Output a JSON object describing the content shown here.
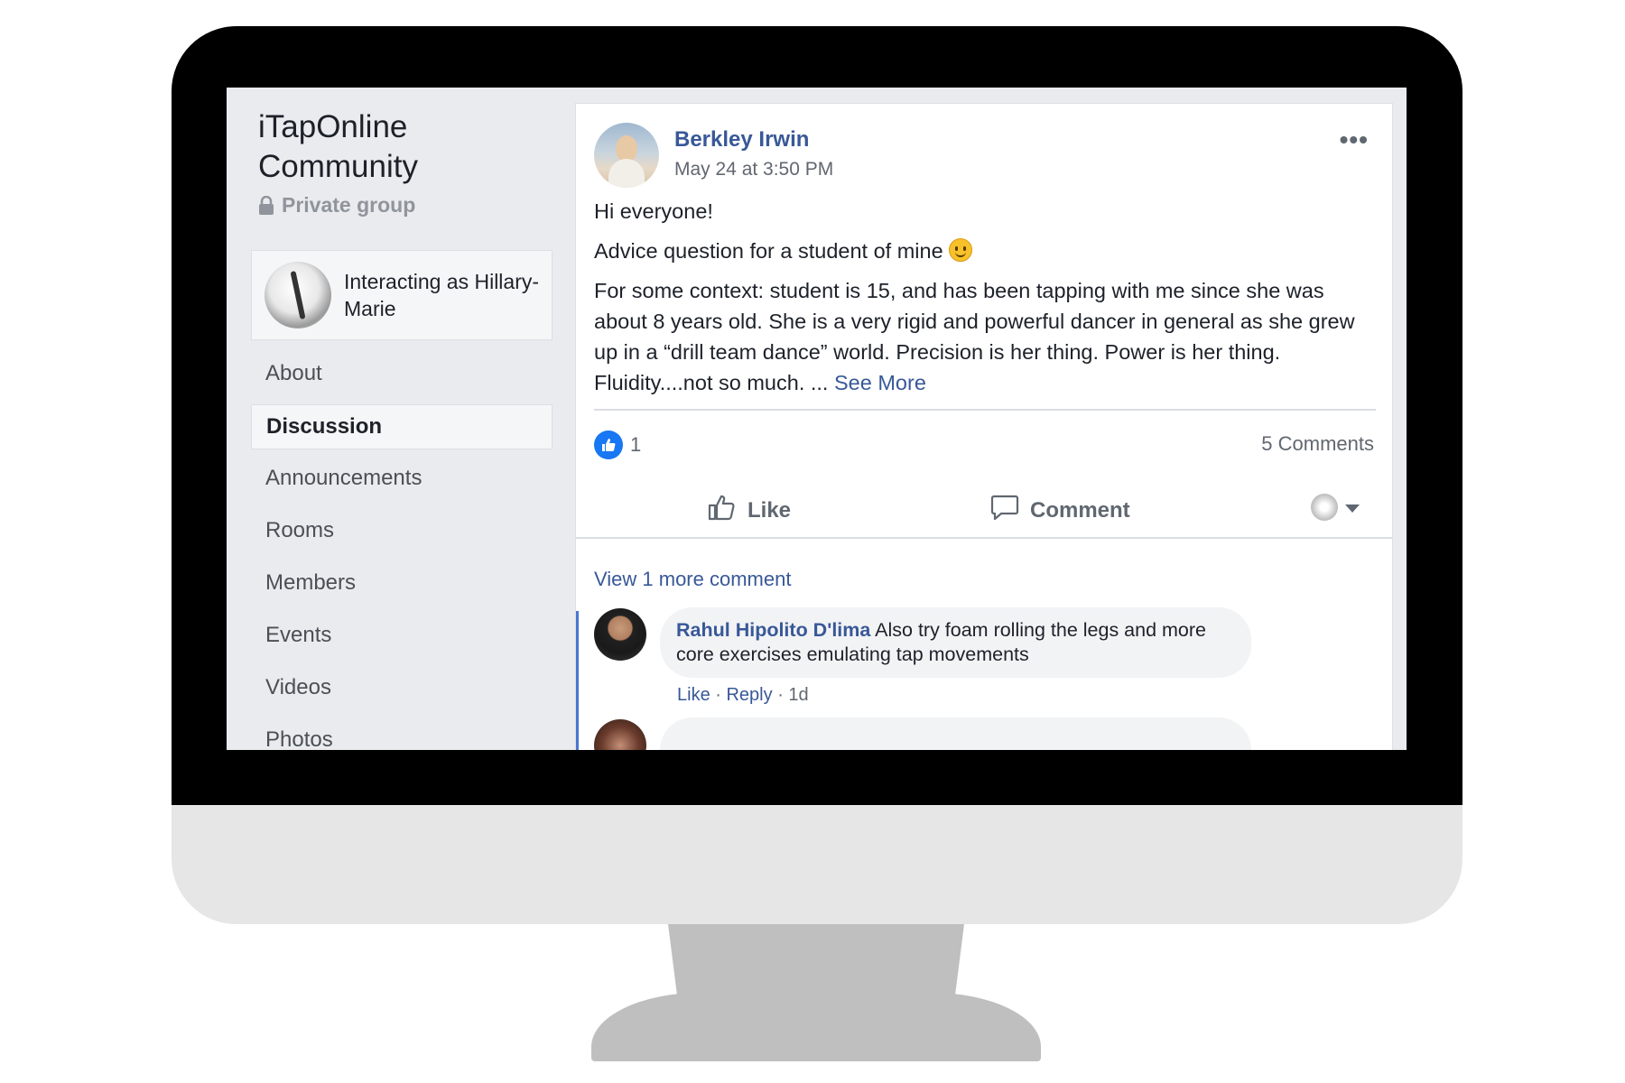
{
  "group": {
    "title": "iTapOnline Community",
    "privacy": "Private group"
  },
  "interacting": {
    "text": "Interacting as Hillary-Marie"
  },
  "nav": {
    "items": [
      {
        "label": "About"
      },
      {
        "label": "Discussion",
        "active": true
      },
      {
        "label": "Announcements"
      },
      {
        "label": "Rooms"
      },
      {
        "label": "Members"
      },
      {
        "label": "Events"
      },
      {
        "label": "Videos"
      },
      {
        "label": "Photos"
      }
    ]
  },
  "post": {
    "author": "Berkley Irwin",
    "timestamp": "May 24 at 3:50 PM",
    "more_icon": "more-horizontal-icon",
    "lines": [
      "Hi everyone!",
      "Advice question for a student of mine",
      "For some context: student is 15, and has been tapping with me since she was about 8 years old. She is a very rigid and powerful dancer in general as she grew up in a “drill team dance” world. Precision is her thing. Power is her thing. Fluidity....not so much. ... "
    ],
    "see_more": "See More",
    "like_count": "1",
    "comments_count": "5 Comments",
    "actions": {
      "like": "Like",
      "comment": "Comment"
    }
  },
  "comments": {
    "view_more": "View 1 more comment",
    "items": [
      {
        "author": "Rahul Hipolito D'lima",
        "text": "Also try foam rolling the legs and more core exercises emulating tap movements",
        "like": "Like",
        "reply": "Reply",
        "age": "1d"
      }
    ]
  },
  "colors": {
    "link": "#385898",
    "like_blue": "#1877f2",
    "background": "#e9ebee"
  }
}
